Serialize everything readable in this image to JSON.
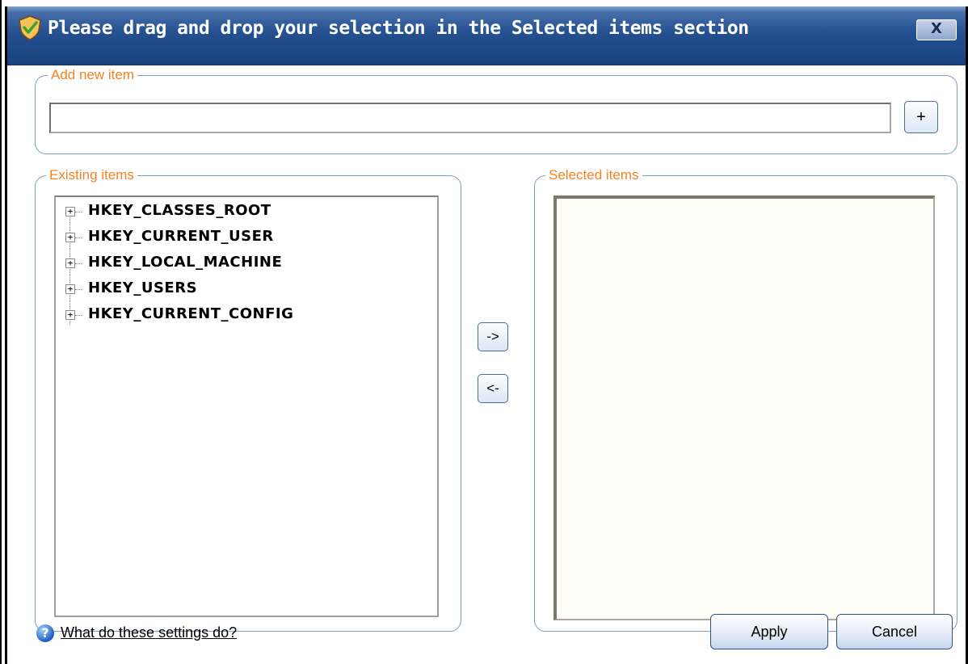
{
  "window": {
    "title": "Please drag and drop your selection in the Selected items section",
    "close_label": "X"
  },
  "add_new": {
    "legend": "Add new item",
    "value": "",
    "add_button": "+"
  },
  "existing": {
    "legend": "Existing items",
    "nodes": [
      {
        "expander": "+",
        "label": "HKEY_CLASSES_ROOT"
      },
      {
        "expander": "+",
        "label": "HKEY_CURRENT_USER"
      },
      {
        "expander": "+",
        "label": "HKEY_LOCAL_MACHINE"
      },
      {
        "expander": "+",
        "label": "HKEY_USERS"
      },
      {
        "expander": "+",
        "label": "HKEY_CURRENT_CONFIG"
      }
    ]
  },
  "transfer": {
    "add_label": "->",
    "remove_label": "<-"
  },
  "selected": {
    "legend": "Selected items",
    "items": []
  },
  "footer": {
    "help_icon": "?",
    "help_text": "What do these settings do?",
    "apply_label": "Apply",
    "cancel_label": "Cancel"
  },
  "colors": {
    "legend": "#f58220",
    "titlebar": "#24508f",
    "group_border": "#7f9db9"
  },
  "icons": {
    "app": "shield-check-icon",
    "help": "question-icon"
  }
}
